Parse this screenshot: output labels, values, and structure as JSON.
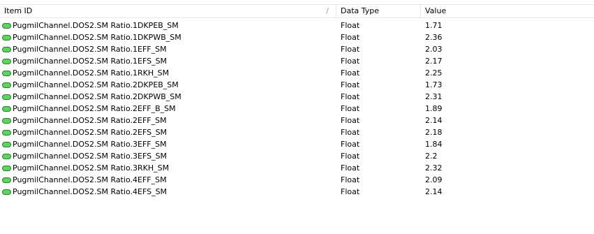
{
  "columns": {
    "item_id": "Item ID",
    "data_type": "Data Type",
    "value": "Value"
  },
  "sort_glyph": "/",
  "icon": "tag-icon",
  "rows": [
    {
      "item_id": "PugmilChannel.DOS2.SM Ratio.1DKPEB_SM",
      "data_type": "Float",
      "value": "1.71"
    },
    {
      "item_id": "PugmilChannel.DOS2.SM Ratio.1DKPWB_SM",
      "data_type": "Float",
      "value": "2.36"
    },
    {
      "item_id": "PugmilChannel.DOS2.SM Ratio.1EFF_SM",
      "data_type": "Float",
      "value": "2.03"
    },
    {
      "item_id": "PugmilChannel.DOS2.SM Ratio.1EFS_SM",
      "data_type": "Float",
      "value": "2.17"
    },
    {
      "item_id": "PugmilChannel.DOS2.SM Ratio.1RKH_SM",
      "data_type": "Float",
      "value": "2.25"
    },
    {
      "item_id": "PugmilChannel.DOS2.SM Ratio.2DKPEB_SM",
      "data_type": "Float",
      "value": "1.73"
    },
    {
      "item_id": "PugmilChannel.DOS2.SM Ratio.2DKPWB_SM",
      "data_type": "Float",
      "value": "2.31"
    },
    {
      "item_id": "PugmilChannel.DOS2.SM Ratio.2EFF_B_SM",
      "data_type": "Float",
      "value": "1.89"
    },
    {
      "item_id": "PugmilChannel.DOS2.SM Ratio.2EFF_SM",
      "data_type": "Float",
      "value": "2.14"
    },
    {
      "item_id": "PugmilChannel.DOS2.SM Ratio.2EFS_SM",
      "data_type": "Float",
      "value": "2.18"
    },
    {
      "item_id": "PugmilChannel.DOS2.SM Ratio.3EFF_SM",
      "data_type": "Float",
      "value": "1.84"
    },
    {
      "item_id": "PugmilChannel.DOS2.SM Ratio.3EFS_SM",
      "data_type": "Float",
      "value": "2.2"
    },
    {
      "item_id": "PugmilChannel.DOS2.SM Ratio.3RKH_SM",
      "data_type": "Float",
      "value": "2.32"
    },
    {
      "item_id": "PugmilChannel.DOS2.SM Ratio.4EFF_SM",
      "data_type": "Float",
      "value": "2.09"
    },
    {
      "item_id": "PugmilChannel.DOS2.SM Ratio.4EFS_SM",
      "data_type": "Float",
      "value": "2.14"
    }
  ]
}
